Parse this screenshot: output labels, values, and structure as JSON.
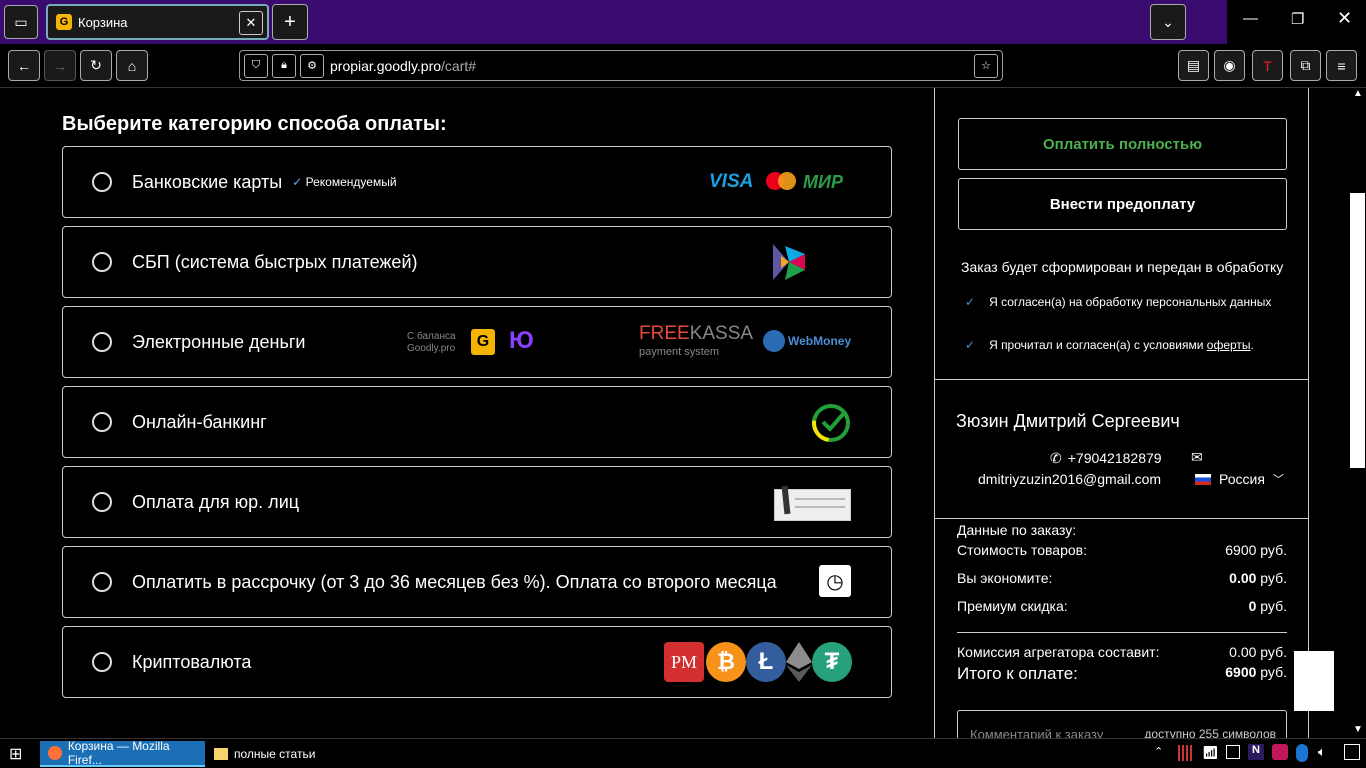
{
  "browser": {
    "tab_title": "Корзина",
    "url_host": "propiar.goodly.pro",
    "url_path": "/cart#"
  },
  "page": {
    "heading": "Выберите категорию способа оплаты:",
    "options": [
      {
        "label": "Банковские карты",
        "badge": "Рекомендуемый"
      },
      {
        "label": "СБП (система быстрых платежей)"
      },
      {
        "label": "Электронные деньги"
      },
      {
        "label": "Онлайн-банкинг"
      },
      {
        "label": "Оплата для юр. лиц"
      },
      {
        "label": "Оплатить в рассрочку (от 3 до 36 месяцев без %). Оплата со второго месяца"
      },
      {
        "label": "Криптовалюта"
      }
    ],
    "logos": {
      "visa": "VISA",
      "mir": "МИР",
      "balance1": "С баланса",
      "balance2": "Goodly.pro",
      "freekassa1": "FREE",
      "freekassa2": "KASSA",
      "freekassa3": "payment system",
      "webmoney": "WebMoney",
      "pm": "PM"
    }
  },
  "sidebar": {
    "pay_full": "Оплатить полностью",
    "prepay": "Внести предоплату",
    "notice": "Заказ будет сформирован и передан в обработку",
    "agree1": "Я согласен(а) на обработку персональных данных",
    "agree2_pre": "Я прочитал и согласен(а) с условиями ",
    "agree2_link": "оферты",
    "agree2_post": ".",
    "name": "Зюзин Дмитрий Сергеевич",
    "phone": "+79042182879",
    "email": "dmitriyzuzin2016@gmail.com",
    "country": "Россия",
    "order_data": "Данные по заказу:",
    "goods_label": "Стоимость товаров:",
    "goods_value": "6900 руб.",
    "save_label": "Вы экономите:",
    "save_num": "0.00",
    "save_unit": " руб.",
    "premium_label": "Премиум скидка:",
    "premium_num": "0",
    "premium_unit": " руб.",
    "fee_label": "Комиссия агрегатора составит:",
    "fee_value": "0.00 руб.",
    "total_label": "Итого к оплате:",
    "total_num": "6900",
    "total_unit": " руб.",
    "comment_placeholder": "Комментарий к заказу",
    "comment_limit": "доступно 255 символов"
  },
  "taskbar": {
    "item1": "Корзина — Mozilla Firef...",
    "item2": "полные статьи"
  },
  "colors": {
    "accent_green": "#4caf50",
    "tab_bg": "#3a0b6e"
  }
}
